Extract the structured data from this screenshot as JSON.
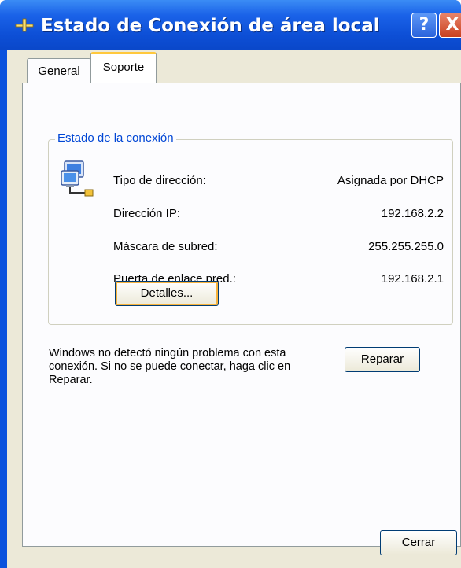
{
  "window": {
    "title": "Estado de Conexión de área local",
    "help_label": "?",
    "close_label": "X"
  },
  "tabs": [
    {
      "label": "General",
      "selected": false
    },
    {
      "label": "Soporte",
      "selected": true
    }
  ],
  "connection_group": {
    "title": "Estado de la conexión",
    "icon": "network-connection-icon",
    "rows": [
      {
        "label": "Tipo de dirección:",
        "value": "Asignada por DHCP"
      },
      {
        "label": "Dirección IP:",
        "value": "192.168.2.2"
      },
      {
        "label": "Máscara de subred:",
        "value": "255.255.255.0"
      },
      {
        "label": "Puerta de enlace pred.:",
        "value": "192.168.2.1"
      }
    ],
    "details_button": "Detalles..."
  },
  "status_message": "Windows no detectó ningún problema con esta conexión. Si no se puede conectar, haga clic en Reparar.",
  "repair_button": "Reparar",
  "close_button": "Cerrar",
  "colors": {
    "titlebar": "#0a52dd",
    "group_title": "#0046d5",
    "dialog_bg": "#ece9d8",
    "tab_highlight": "#ffc83c"
  }
}
